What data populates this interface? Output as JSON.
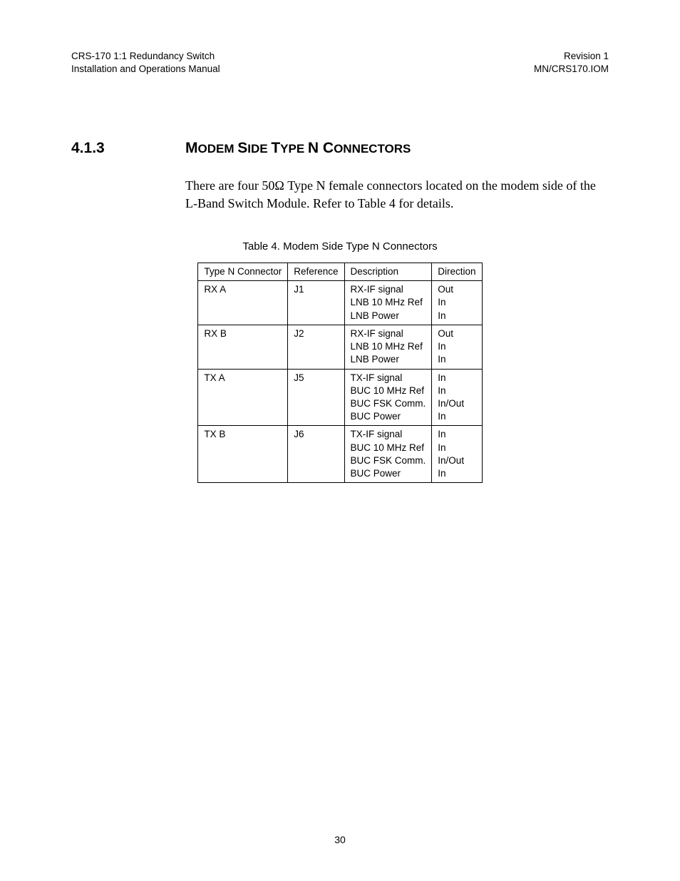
{
  "header": {
    "left_line1": "CRS-170 1:1 Redundancy Switch",
    "left_line2": "Installation and Operations Manual",
    "right_line1": "Revision 1",
    "right_line2": "MN/CRS170.IOM"
  },
  "section": {
    "number": "4.1.3",
    "title_parts": {
      "M": "M",
      "odem": "ODEM ",
      "S": "S",
      "ide": "IDE ",
      "T": "T",
      "ype": "YPE ",
      "N": "N ",
      "C": "C",
      "onnectors": "ONNECTORS"
    }
  },
  "paragraph": "There are four 50Ω Type N female connectors located on the modem side of the L-Band Switch Module. Refer to Table 4 for details.",
  "table_caption": "Table 4.  Modem Side Type N Connectors",
  "table": {
    "headers": [
      "Type N Connector",
      "Reference",
      "Description",
      "Direction"
    ],
    "rows": [
      {
        "connector": "RX A",
        "reference": "J1",
        "desc": [
          "RX-IF signal",
          "LNB 10 MHz Ref",
          "LNB Power"
        ],
        "dir": [
          "Out",
          "In",
          "In"
        ]
      },
      {
        "connector": "RX B",
        "reference": "J2",
        "desc": [
          "RX-IF signal",
          "LNB 10 MHz Ref",
          "LNB Power"
        ],
        "dir": [
          "Out",
          "In",
          "In"
        ]
      },
      {
        "connector": "TX A",
        "reference": "J5",
        "desc": [
          "TX-IF signal",
          "BUC 10 MHz Ref",
          "BUC FSK Comm.",
          "BUC Power"
        ],
        "dir": [
          "In",
          "In",
          "In/Out",
          "In"
        ]
      },
      {
        "connector": "TX B",
        "reference": "J6",
        "desc": [
          "TX-IF signal",
          "BUC 10 MHz Ref",
          "BUC FSK Comm.",
          "BUC Power"
        ],
        "dir": [
          "In",
          "In",
          "In/Out",
          "In"
        ]
      }
    ]
  },
  "page_number": "30"
}
